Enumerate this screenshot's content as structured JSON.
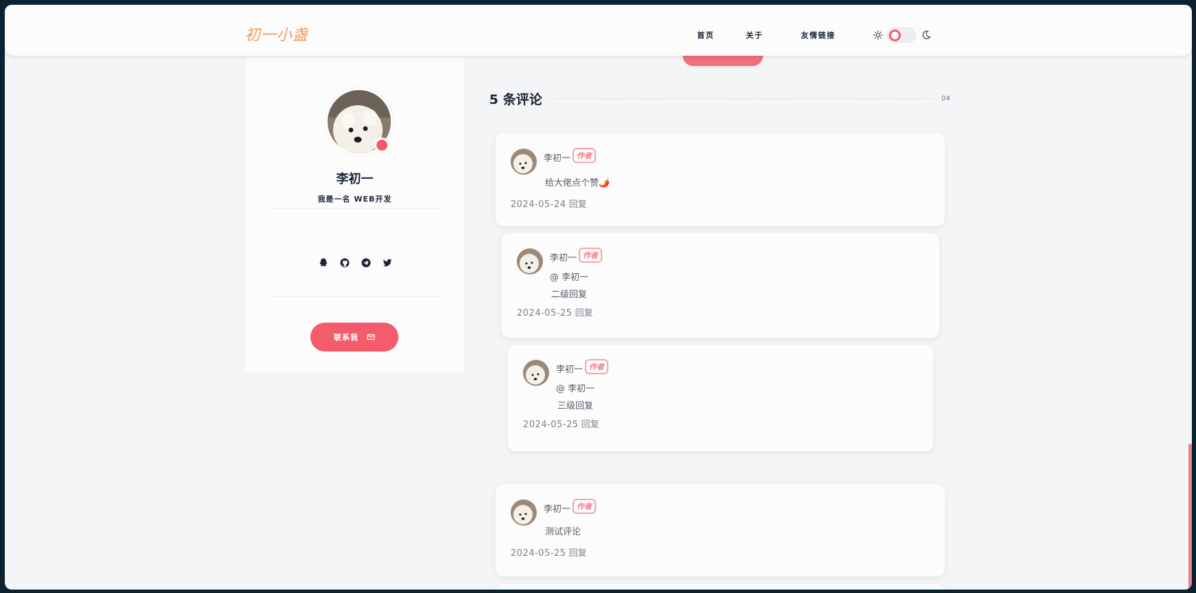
{
  "header": {
    "logo": "初一小盏",
    "nav": [
      "首页",
      "关于",
      "友情链接"
    ],
    "theme_icons": [
      "sun-icon",
      "moon-icon"
    ]
  },
  "profile": {
    "name": "李初一",
    "bio": "我是一名 WEB开发",
    "socials": [
      "qq-icon",
      "github-icon",
      "telegram-icon",
      "twitter-icon"
    ],
    "contact_label": "联系我",
    "status_color": "#f25a6b"
  },
  "comments": {
    "title": "5 条评论",
    "count": "04",
    "items": [
      {
        "author": "李初一",
        "badge": "作者",
        "mention": "",
        "text": "给大佬点个赞🌶️",
        "date": "2024-05-24",
        "reply": "回复"
      },
      {
        "author": "李初一",
        "badge": "作者",
        "mention": "@ 李初一",
        "text": "二级回复",
        "date": "2024-05-25",
        "reply": "回复"
      },
      {
        "author": "李初一",
        "badge": "作者",
        "mention": "@ 李初一",
        "text": "三级回复",
        "date": "2024-05-25",
        "reply": "回复"
      },
      {
        "author": "李初一",
        "badge": "作者",
        "mention": "",
        "text": "测试评论",
        "date": "2024-05-25",
        "reply": "回复"
      }
    ]
  },
  "colors": {
    "accent": "#f45c6c",
    "badge_border": "#f5a3ac",
    "background": "#f4f5f7",
    "frame": "#0d2230"
  }
}
